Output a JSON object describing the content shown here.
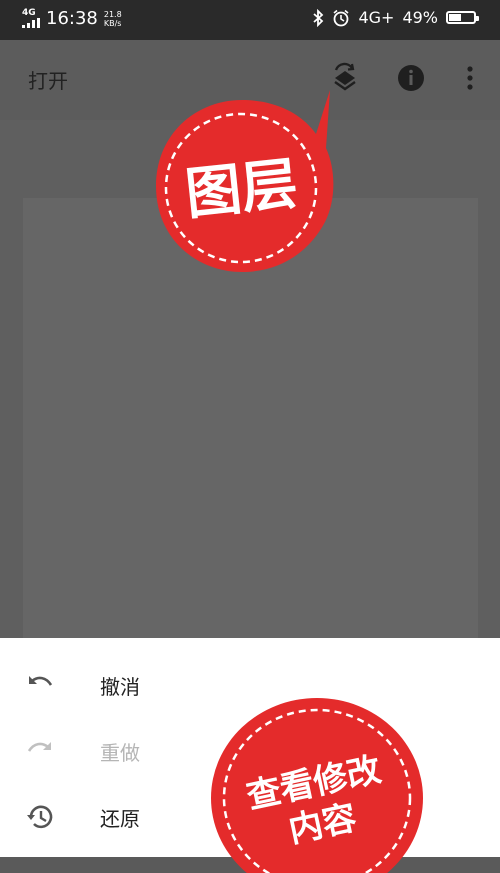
{
  "status_bar": {
    "network_top": "4G",
    "time": "16:38",
    "speed_value": "21.8",
    "speed_unit": "KB/s",
    "network_right": "4G+",
    "battery": "49%",
    "battery_level": 0.49
  },
  "app_bar": {
    "open_label": "打开"
  },
  "menu": {
    "items": [
      {
        "label": "撤消",
        "enabled": true
      },
      {
        "label": "重做",
        "enabled": false
      },
      {
        "label": "还原",
        "enabled": true
      }
    ]
  },
  "annotations": {
    "layers_bubble": "图层",
    "edit_bubble_line1": "查看修改",
    "edit_bubble_line2": "内容"
  },
  "colors": {
    "bubble_red": "#e42b2b",
    "sheet_bg": "#ffffff",
    "overlay": "#5f5f5f"
  }
}
